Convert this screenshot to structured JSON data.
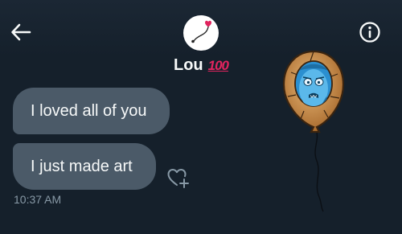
{
  "header": {
    "contact_name": "Lou",
    "name_emoji": "100",
    "back_icon": "arrow-left-icon",
    "info_icon": "info-icon",
    "avatar_icon": "heart-balloon-avatar"
  },
  "messages": [
    {
      "text": "I loved all of you"
    },
    {
      "text": "I just made art"
    }
  ],
  "timestamp": "10:37 AM",
  "reaction_icon": "add-reaction-heart-icon",
  "sticker": "blue-face-balloon-sticker",
  "colors": {
    "background": "#15202b",
    "bubble": "#4b5a68",
    "text": "#f7f9f9",
    "muted": "#8899a6",
    "accent_red": "#e0245e"
  }
}
